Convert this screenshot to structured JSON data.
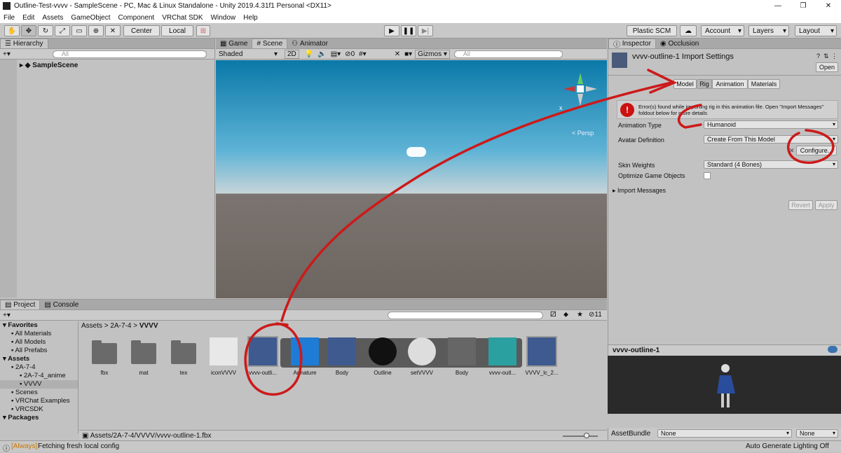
{
  "window": {
    "title": "Outline-Test-vvvv - SampleScene - PC, Mac & Linux Standalone - Unity 2019.4.31f1 Personal <DX11>",
    "min": "—",
    "max": "❐",
    "close": "✕"
  },
  "menu": [
    "File",
    "Edit",
    "Assets",
    "GameObject",
    "Component",
    "VRChat SDK",
    "Window",
    "Help"
  ],
  "toolbar": {
    "center": "Center",
    "local": "Local",
    "plastic": "Plastic SCM",
    "account": "Account",
    "layers": "Layers",
    "layout": "Layout"
  },
  "hierarchy": {
    "tab": "Hierarchy",
    "search_placeholder": "All",
    "scene": "SampleScene"
  },
  "sceneview": {
    "tabs": [
      "Game",
      "Scene",
      "Animator"
    ],
    "shading": "Shaded",
    "mode2d": "2D",
    "hidden_count": "0",
    "gizmos": "Gizmos",
    "search_placeholder": "All",
    "persp": "< Persp",
    "axis_x": "x"
  },
  "inspector": {
    "tabs": [
      "Inspector",
      "Occlusion"
    ],
    "title": "vvvv-outline-1 Import Settings",
    "open": "Open",
    "import_tabs": [
      "Model",
      "Rig",
      "Animation",
      "Materials"
    ],
    "error": "Error(s) found while importing rig in this animation file. Open \"Import Messages\" foldout below for more details",
    "anim_type_label": "Animation Type",
    "anim_type": "Humanoid",
    "avatar_def_label": "Avatar Definition",
    "avatar_def": "Create From This Model",
    "configure": "Configure...",
    "skin_label": "Skin Weights",
    "skin": "Standard (4 Bones)",
    "optimize_label": "Optimize Game Objects",
    "import_messages": "Import Messages",
    "revert": "Revert",
    "apply": "Apply",
    "preview_title": "vvvv-outline-1",
    "assetbundle_label": "AssetBundle",
    "assetbundle": "None",
    "variant": "None"
  },
  "project": {
    "tabs": [
      "Project",
      "Console"
    ],
    "count": "11",
    "tree": [
      [
        "Favorites",
        0
      ],
      [
        "All Materials",
        1
      ],
      [
        "All Models",
        1
      ],
      [
        "All Prefabs",
        1
      ],
      [
        "Assets",
        0
      ],
      [
        "2A-7-4",
        1
      ],
      [
        "2A-7-4_anime",
        2
      ],
      [
        "VVVV",
        2
      ],
      [
        "Scenes",
        1
      ],
      [
        "VRChat Examples",
        1
      ],
      [
        "VRCSDK",
        1
      ],
      [
        "Packages",
        0
      ]
    ],
    "breadcrumb": [
      "Assets",
      "2A-7-4",
      "VVVV"
    ],
    "assets": [
      "fbx",
      "mat",
      "tex",
      "iconVVVV",
      "vvvv-outli...",
      "Armature",
      "Body",
      "Outline",
      "setVVVV",
      "Body",
      "vvvv-outl...",
      "VVVV_lc_2..."
    ],
    "path": "Assets/2A-7-4/VVVV/vvvv-outline-1.fbx"
  },
  "status": {
    "tag": "[Always]",
    "message": "Fetching fresh local config",
    "right": "Auto Generate Lighting Off"
  },
  "colors": {
    "annotation": "#cc1a1a",
    "selected": "#3a72b0"
  }
}
